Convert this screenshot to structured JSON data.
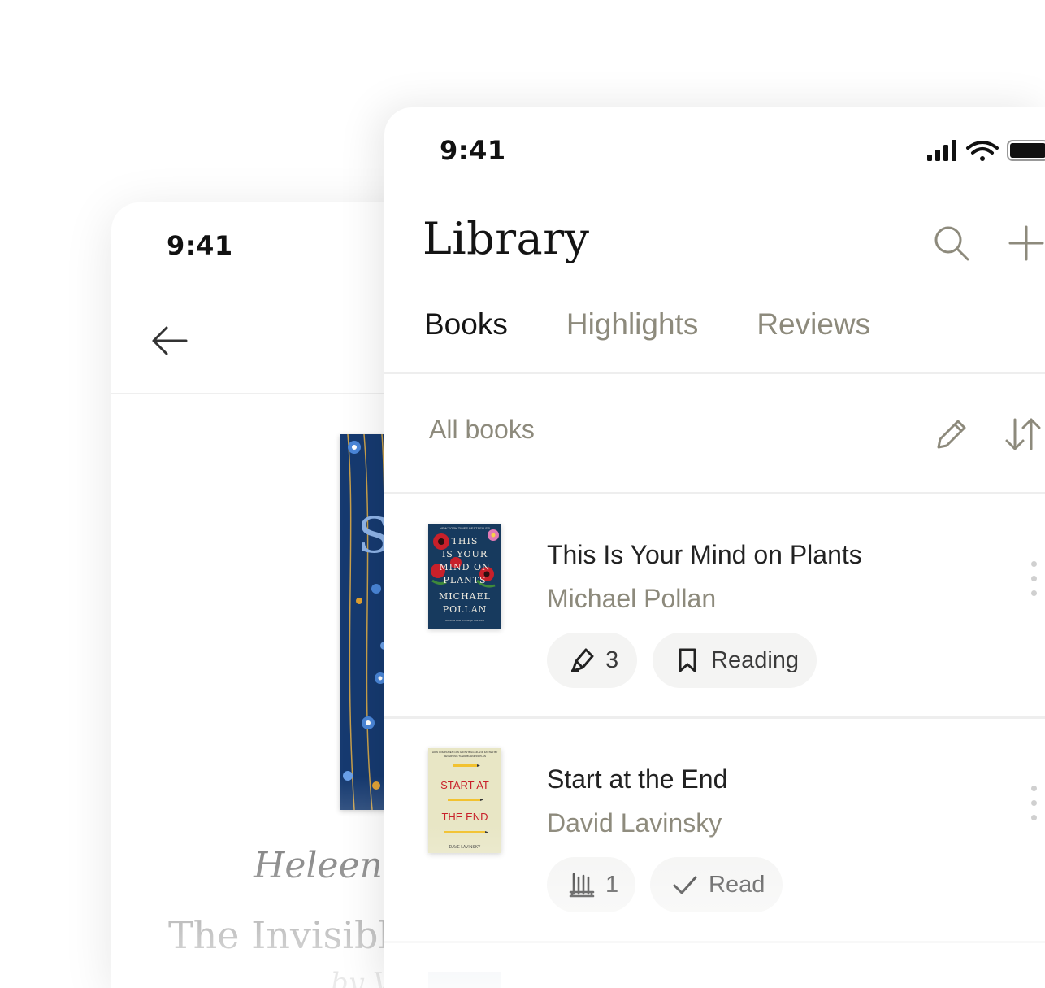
{
  "back_screen": {
    "status_time": "9:41",
    "author_text": "Heleen C",
    "title_text": "The Invisible",
    "subtitle_text": "by V",
    "cover_letter": "S"
  },
  "front_screen": {
    "status_time": "9:41",
    "title": "Library",
    "tabs": [
      {
        "label": "Books",
        "active": true
      },
      {
        "label": "Highlights",
        "active": false
      },
      {
        "label": "Reviews",
        "active": false
      }
    ],
    "filter_label": "All books",
    "books": [
      {
        "title": "This Is Your Mind on Plants",
        "author": "Michael Pollan",
        "count_icon": "highlighter-icon",
        "count": "3",
        "status_icon": "bookmark-icon",
        "status": "Reading",
        "cover": {
          "colors": {
            "bg": "#173a5e",
            "accent": "#c8202a"
          },
          "top_line": "NEW YORK TIMES BESTSELLER",
          "title_lines": [
            "THIS",
            "IS YOUR",
            "MIND ON",
            "PLANTS"
          ],
          "author_lines": [
            "MICHAEL",
            "POLLAN"
          ],
          "tagline": "Author of How to Change Your Mind"
        }
      },
      {
        "title": "Start at the End",
        "author": "David Lavinsky",
        "count_icon": "bookshelf-icon",
        "count": "1",
        "status_icon": "checkmark-icon",
        "status": "Read",
        "cover": {
          "colors": {
            "bg": "#e8e6c5",
            "text": "#c8202a"
          },
          "top_line": "HOW COMPANIES CAN GROW BIGGER AND FASTER BY REVERSING THEIR BUSINESS PLAN",
          "title_lines": [
            "START AT",
            "THE END"
          ],
          "author_lines": [
            "DAVE LAVINSKY"
          ]
        }
      }
    ]
  },
  "colors": {
    "muted": "#8d8a7c",
    "text": "#141414",
    "chip_bg": "#f4f4f3"
  }
}
